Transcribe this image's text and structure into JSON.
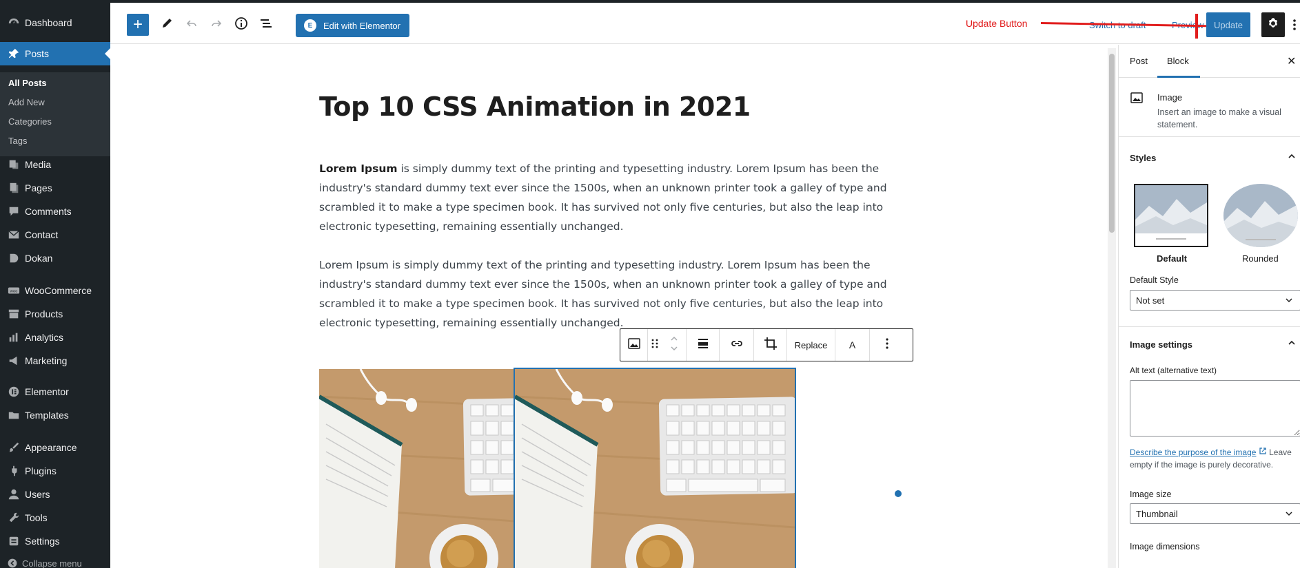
{
  "sidebar": {
    "items": [
      {
        "label": "Dashboard",
        "icon": "dashboard-icon"
      },
      {
        "label": "Posts",
        "icon": "pin-icon"
      },
      {
        "label": "Media",
        "icon": "media-icon"
      },
      {
        "label": "Pages",
        "icon": "pages-icon"
      },
      {
        "label": "Comments",
        "icon": "comments-icon"
      },
      {
        "label": "Contact",
        "icon": "mail-icon"
      },
      {
        "label": "Dokan",
        "icon": "dokan-icon"
      },
      {
        "label": "WooCommerce",
        "icon": "woo-icon"
      },
      {
        "label": "Products",
        "icon": "archive-icon"
      },
      {
        "label": "Analytics",
        "icon": "bar-chart-icon"
      },
      {
        "label": "Marketing",
        "icon": "megaphone-icon"
      },
      {
        "label": "Elementor",
        "icon": "elementor-icon"
      },
      {
        "label": "Templates",
        "icon": "folder-icon"
      },
      {
        "label": "Appearance",
        "icon": "brush-icon"
      },
      {
        "label": "Plugins",
        "icon": "plug-icon"
      },
      {
        "label": "Users",
        "icon": "user-icon"
      },
      {
        "label": "Tools",
        "icon": "wrench-icon"
      },
      {
        "label": "Settings",
        "icon": "settings-icon"
      }
    ],
    "submenu": [
      "All Posts",
      "Add New",
      "Categories",
      "Tags"
    ],
    "collapse_label": "Collapse menu"
  },
  "header": {
    "elementor_label": "Edit with Elementor",
    "elementor_badge": "E",
    "annotation": "Update Button",
    "switch_draft": "Switch to draft",
    "preview": "Preview",
    "update": "Update"
  },
  "post": {
    "title": "Top 10 CSS Animation in 2021",
    "para1_bold": "Lorem Ipsum",
    "para1_rest": " is simply dummy text of the printing and typesetting industry. Lorem Ipsum has been the industry's standard dummy text ever since the 1500s, when an unknown printer took a galley of type and scrambled it to make a type specimen book. It has survived not only five centuries, but also the leap into electronic typesetting, remaining essentially unchanged.",
    "para2": "Lorem Ipsum is simply dummy text of the printing and typesetting industry. Lorem Ipsum has been the industry's standard dummy text ever since the 1500s, when an unknown printer took a galley of type and scrambled it to make a type specimen book. It has survived not only five centuries, but also the leap into electronic typesetting, remaining essentially unchanged."
  },
  "block_toolbar": {
    "replace": "Replace",
    "text_tool": "A"
  },
  "panel": {
    "tab_post": "Post",
    "tab_block": "Block",
    "close": "✕",
    "block_name": "Image",
    "block_desc": "Insert an image to make a visual statement.",
    "styles_title": "Styles",
    "style_default": "Default",
    "style_rounded": "Rounded",
    "default_style_label": "Default Style",
    "default_style_value": "Not set",
    "image_settings_title": "Image settings",
    "alt_label": "Alt text (alternative text)",
    "alt_help_link": "Describe the purpose of the image",
    "alt_help_rest": " Leave empty if the image is purely decorative.",
    "image_size_label": "Image size",
    "image_size_value": "Thumbnail",
    "image_dimensions_label": "Image dimensions"
  }
}
